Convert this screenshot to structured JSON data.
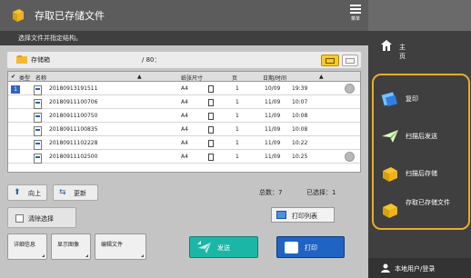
{
  "window": {
    "title": "存取已存储文件",
    "menu_label": "菜单",
    "menu_icon": "hamburger-menu-icon"
  },
  "instruction": "选择文件并指定结构。",
  "folder": {
    "name": "存储箱",
    "page_count": "/ 80："
  },
  "table": {
    "headers": [
      "类型",
      "名称",
      "纸张尺寸",
      "页",
      "日期/时间"
    ],
    "rows": [
      {
        "name": "20180913191511",
        "size": "A4",
        "pages": "1",
        "date": "10/09",
        "time": "19:39",
        "selected": true
      },
      {
        "name": "20180911100706",
        "size": "A4",
        "pages": "1",
        "date": "11/09",
        "time": "10:07"
      },
      {
        "name": "20180911100750",
        "size": "A4",
        "pages": "1",
        "date": "11/09",
        "time": "10:08"
      },
      {
        "name": "20180911100835",
        "size": "A4",
        "pages": "1",
        "date": "11/09",
        "time": "10:08"
      },
      {
        "name": "20180911102228",
        "size": "A4",
        "pages": "1",
        "date": "11/09",
        "time": "10:22"
      },
      {
        "name": "20180911102500",
        "size": "A4",
        "pages": "1",
        "date": "11/09",
        "time": "10:25"
      }
    ]
  },
  "navigation": {
    "up": "向上",
    "refresh": "更新"
  },
  "counts": {
    "total": "总数：7",
    "selected": "已选择：1"
  },
  "actions": {
    "clear_selection": "清除选择",
    "print_list": "打印列表",
    "details": "详细信息",
    "preview": "显示图像",
    "edit": "编辑文件",
    "send": "发送",
    "print": "打印"
  },
  "sidebar": {
    "home": "主页",
    "items": [
      {
        "label": "复印",
        "icon": "copy-icon"
      },
      {
        "label": "扫描后发送",
        "icon": "scan-send-icon"
      },
      {
        "label": "扫描后存储",
        "icon": "scan-store-icon"
      },
      {
        "label": "存取已存储文件",
        "icon": "stored-files-icon"
      }
    ],
    "user": "本地用户/登录"
  },
  "colors": {
    "highlight": "#e6ad2b",
    "send": "#1bb6a6",
    "print": "#1f64c3",
    "selection": "#2f64c6"
  }
}
